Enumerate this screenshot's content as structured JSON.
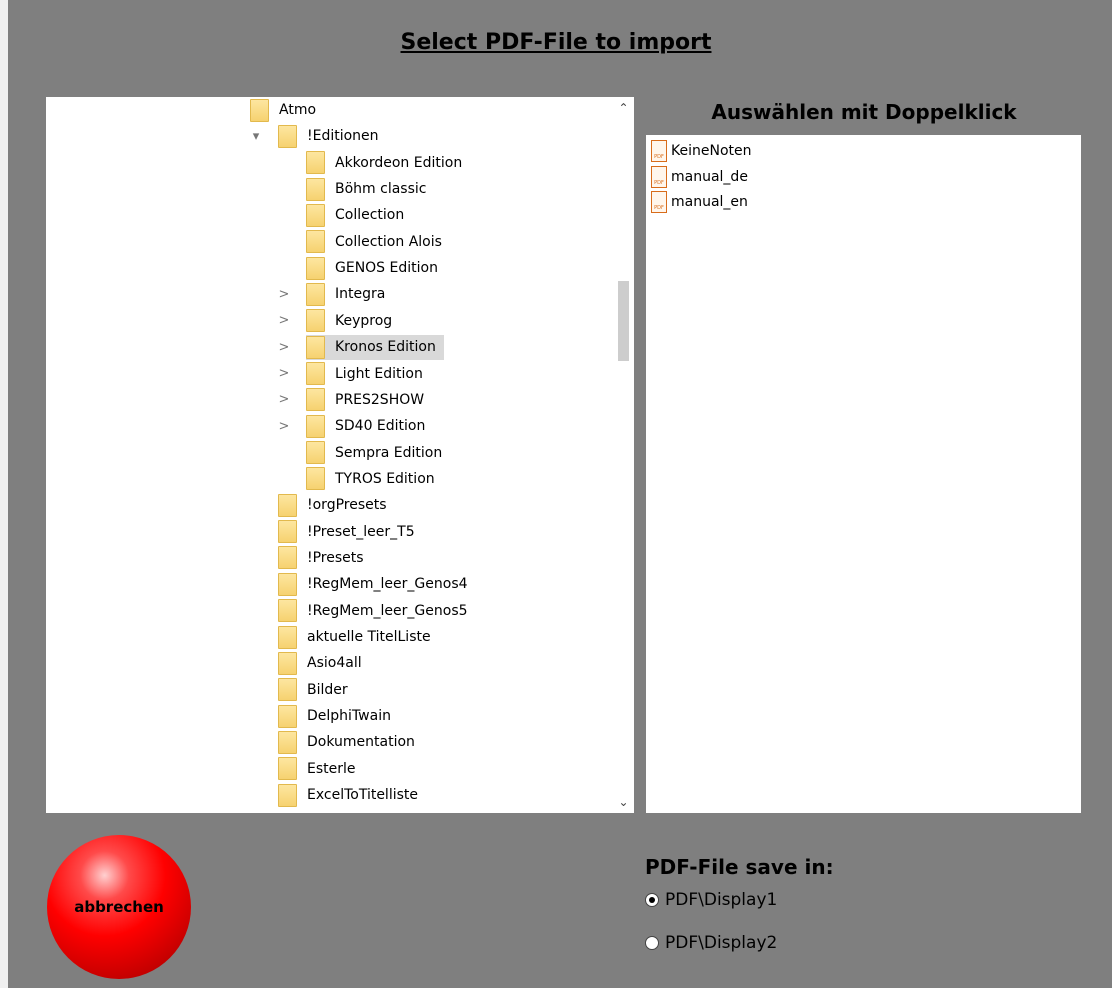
{
  "dialog": {
    "title": "Select PDF-File to import"
  },
  "folder_tree": {
    "items": [
      {
        "label": "Atmo",
        "expander": ""
      },
      {
        "label": "!Editionen",
        "expander": "▾"
      },
      {
        "label": "Akkordeon Edition",
        "expander": ""
      },
      {
        "label": "Böhm classic",
        "expander": ""
      },
      {
        "label": "Collection",
        "expander": ""
      },
      {
        "label": "Collection Alois",
        "expander": ""
      },
      {
        "label": "GENOS Edition",
        "expander": ""
      },
      {
        "label": "Integra",
        "expander": ">"
      },
      {
        "label": "Keyprog",
        "expander": ">"
      },
      {
        "label": "Kronos Edition",
        "expander": ">",
        "selected": true
      },
      {
        "label": "Light Edition",
        "expander": ">"
      },
      {
        "label": "PRES2SHOW",
        "expander": ">"
      },
      {
        "label": "SD40 Edition",
        "expander": ">"
      },
      {
        "label": "Sempra Edition",
        "expander": ""
      },
      {
        "label": "TYROS Edition",
        "expander": ""
      },
      {
        "label": "!orgPresets",
        "expander": ""
      },
      {
        "label": "!Preset_leer_T5",
        "expander": ""
      },
      {
        "label": "!Presets",
        "expander": ""
      },
      {
        "label": "!RegMem_leer_Genos4",
        "expander": ""
      },
      {
        "label": "!RegMem_leer_Genos5",
        "expander": ""
      },
      {
        "label": "aktuelle TitelListe",
        "expander": ""
      },
      {
        "label": "Asio4all",
        "expander": ""
      },
      {
        "label": "Bilder",
        "expander": ""
      },
      {
        "label": "DelphiTwain",
        "expander": ""
      },
      {
        "label": "Dokumentation",
        "expander": ""
      },
      {
        "label": "Esterle",
        "expander": ""
      },
      {
        "label": "ExcelToTitelliste",
        "expander": ""
      }
    ]
  },
  "file_list": {
    "heading": "Auswählen mit Doppelklick",
    "files": [
      "KeineNoten",
      "manual_de",
      "manual_en"
    ]
  },
  "cancel_button": {
    "label": "abbrechen",
    "color": "#ff0000"
  },
  "save_location": {
    "heading": "PDF-File save in:",
    "options": [
      {
        "label": "PDF\\Display1",
        "selected": true
      },
      {
        "label": "PDF\\Display2",
        "selected": false
      }
    ]
  }
}
